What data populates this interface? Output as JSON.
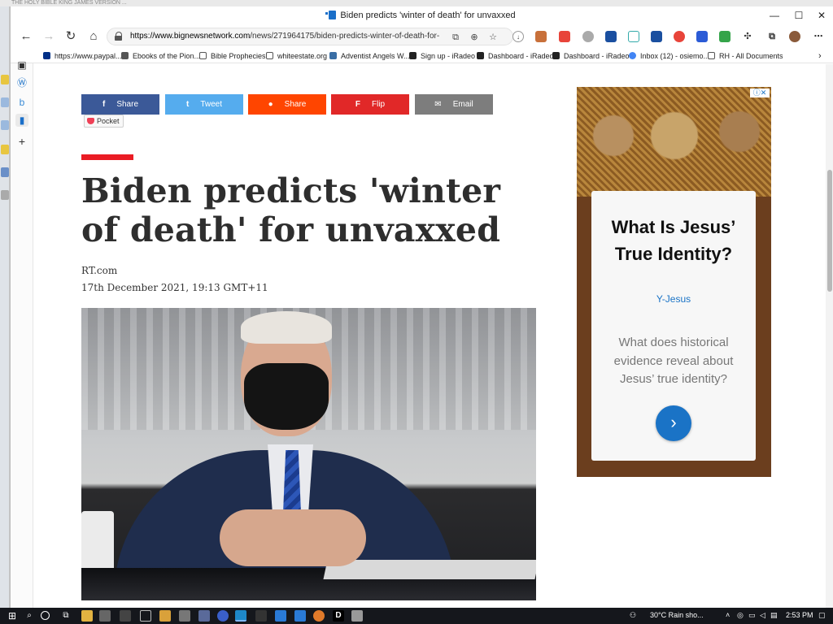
{
  "background_app_title": "THE HOLY BIBLE KING JAMES VERSION ...",
  "window": {
    "tab_title": "Biden predicts 'winter of death' for unvaxxed",
    "minimize": "—",
    "maximize": "☐",
    "close": "✕"
  },
  "nav": {
    "back": "←",
    "forward": "→",
    "refresh": "↻",
    "home": "⌂",
    "url_host": "https://www.bignewsnetwork.com",
    "url_path": "/news/271964175/biden-predicts-winter-of-death-for-unvax..."
  },
  "favorites": [
    {
      "label": "https://www.paypal....",
      "color": "#003087"
    },
    {
      "label": "Ebooks of the Pion...",
      "color": "#555555"
    },
    {
      "label": "Bible Prophecies",
      "color": "#ffffff"
    },
    {
      "label": "whiteestate.org",
      "color": "#ffffff"
    },
    {
      "label": "Adventist Angels W...",
      "color": "#3a6ea5"
    },
    {
      "label": "Sign up - iRadeo",
      "color": "#222222"
    },
    {
      "label": "Dashboard - iRadeo",
      "color": "#222222"
    },
    {
      "label": "Dashboard - iRadeo",
      "color": "#222222"
    },
    {
      "label": "Inbox (12) - osiemo...",
      "color": "#4285f4"
    },
    {
      "label": "RH - All Documents",
      "color": "#ffffff"
    }
  ],
  "share_buttons": [
    {
      "label": "Share",
      "icon": "f",
      "color": "#3b5998"
    },
    {
      "label": "Tweet",
      "icon": "t",
      "color": "#55acee"
    },
    {
      "label": "Share",
      "icon": "●",
      "color": "#ff4500"
    },
    {
      "label": "Flip",
      "icon": "F",
      "color": "#e12828"
    },
    {
      "label": "Email",
      "icon": "✉",
      "color": "#7d7d7d"
    }
  ],
  "pocket_label": "Pocket",
  "article": {
    "headline": "Biden predicts 'winter of death' for unvaxxed",
    "source": "RT.com",
    "date": "17th December 2021, 19:13 GMT+11"
  },
  "ad": {
    "adchoices": "ⓘ✕",
    "title": "What Is Jesus’ True Identity?",
    "brand": "Y-Jesus",
    "body": "What does historical evidence reveal about Jesus’ true identity?",
    "cta": "›"
  },
  "taskbar": {
    "weather": "30°C  Rain sho...",
    "time": "2:53 PM"
  }
}
